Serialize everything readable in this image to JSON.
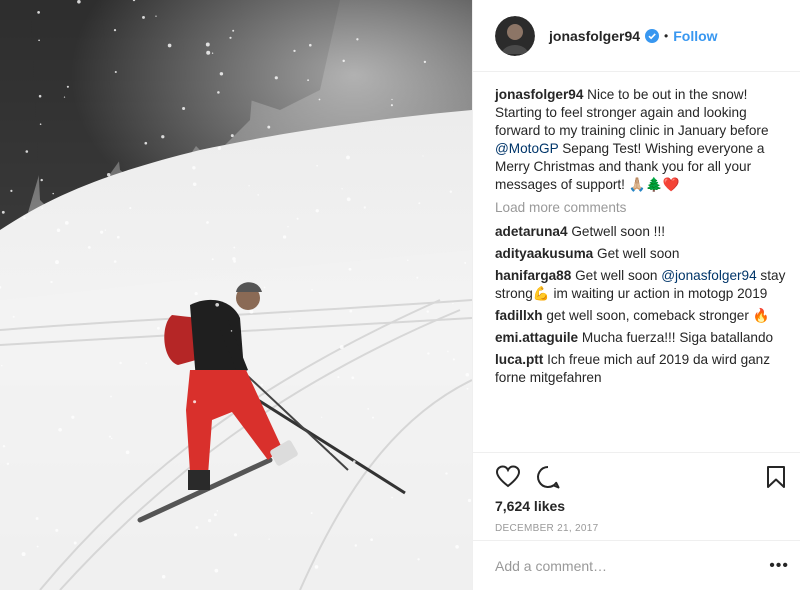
{
  "post": {
    "username": "jonasfolger94",
    "follow_label": "Follow",
    "separator": "•",
    "caption": {
      "username": "jonasfolger94",
      "text_1": "Nice to be out in the snow! Starting to feel stronger again and looking forward to my training clinic in January before ",
      "mention": "@MotoGP",
      "text_2": " Sepang Test! Wishing everyone a Merry Christmas and thank you for all your messages of support! 🙏🏼🌲❤️"
    },
    "load_more_label": "Load more comments",
    "comments": [
      {
        "user": "adetaruna4",
        "text": "Getwell soon !!!"
      },
      {
        "user": "adityaakusuma",
        "text": "Get well soon"
      },
      {
        "user": "hanifarga88",
        "text_1": "Get well soon ",
        "mention": "@jonasfolger94",
        "text_2": " stay strong💪 im waiting ur action in motogp 2019"
      },
      {
        "user": "fadillxh",
        "text": "get well soon, comeback stronger 🔥"
      },
      {
        "user": "emi.attaguile",
        "text": "Mucha fuerza!!! Siga batallando"
      },
      {
        "user": "luca.ptt",
        "text": "Ich freue mich auf 2019 da wird ganz forne mitgefahren"
      }
    ],
    "likes": "7,624 likes",
    "date": "DECEMBER 21, 2017",
    "add_comment_placeholder": "Add a comment…",
    "more_label": "•••"
  },
  "icons": {
    "verified": "verified-badge-icon",
    "like": "heart-icon",
    "comment": "comment-bubble-icon",
    "save": "bookmark-icon"
  },
  "colors": {
    "link": "#3897f0",
    "verified": "#3897f0",
    "mention": "#003569",
    "muted": "#999999",
    "pants": "#d9302c"
  }
}
